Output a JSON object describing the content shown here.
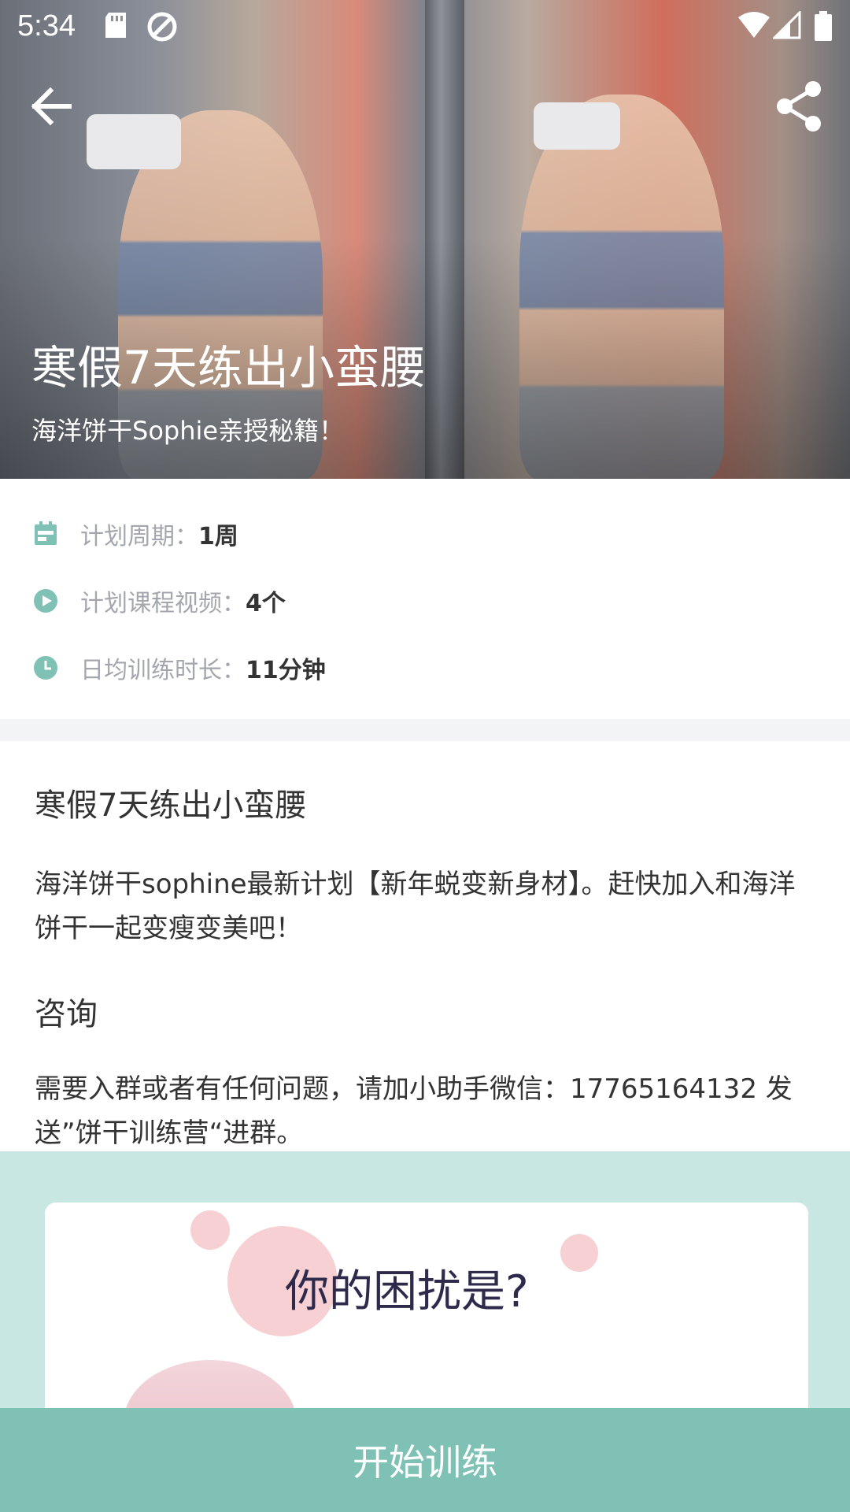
{
  "status_bar": {
    "time": "5:34",
    "icons": [
      "sd-card-icon",
      "no-disturb-icon",
      "wifi-icon",
      "signal-icon",
      "battery-icon"
    ]
  },
  "header": {
    "back_icon": "arrow-left-icon",
    "share_icon": "share-icon"
  },
  "hero": {
    "title": "寒假7天练出小蛮腰",
    "subtitle": "海洋饼干Sophie亲授秘籍！"
  },
  "info": {
    "items": [
      {
        "icon": "calendar-icon",
        "label": "计划周期：",
        "value": "1周"
      },
      {
        "icon": "play-icon",
        "label": "计划课程视频：",
        "value": "4个"
      },
      {
        "icon": "clock-icon",
        "label": "日均训练时长：",
        "value": "11分钟"
      }
    ],
    "accent_color": "#80c1b5"
  },
  "description": {
    "title": "寒假7天练出小蛮腰",
    "body": "海洋饼干sophine最新计划【新年蜕变新身材】。赶快加入和海洋饼干一起变瘦变美吧！"
  },
  "consult": {
    "title": "咨询",
    "body": "需要入群或者有任何问题，请加小助手微信：17765164132 发送”饼干训练营“进群。"
  },
  "promo": {
    "text": "你的困扰是?"
  },
  "footer": {
    "start_button": "开始训练"
  }
}
